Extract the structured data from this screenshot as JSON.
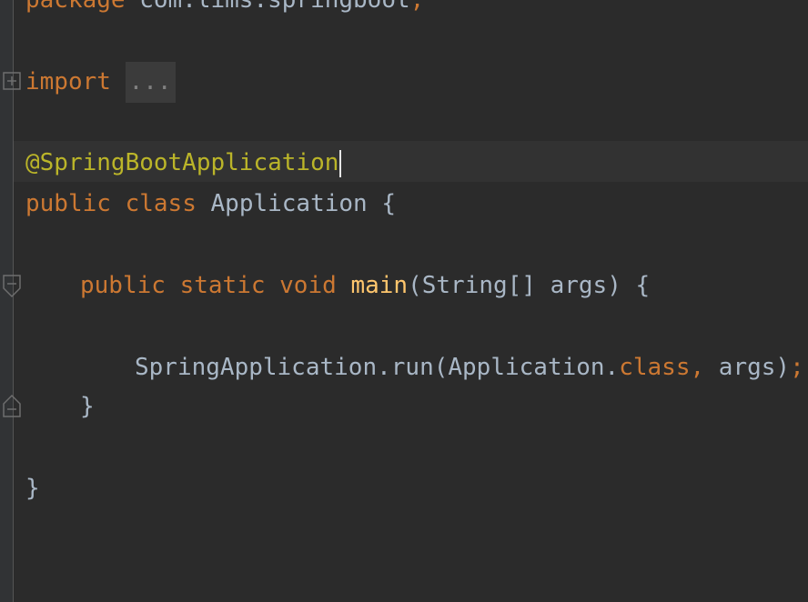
{
  "editor": {
    "colors": {
      "background": "#2b2b2b",
      "keyword": "#cc7832",
      "annotation": "#bbb529",
      "method": "#ffc66d",
      "text": "#a9b7c6",
      "folded": "#808080"
    },
    "lines": {
      "l1_kw": "package",
      "l1_rest": " com.lims.springboot",
      "l1_semi": ";",
      "l2_kw": "import",
      "l2_folded": "...",
      "l3_annotation": "@SpringBootApplication",
      "l4_kw1": "public",
      "l4_kw2": "class",
      "l4_rest": " Application {",
      "l5_kw1": "public",
      "l5_kw2": "static",
      "l5_kw3": "void",
      "l5_fn": "main",
      "l5_rest": "(String[] args) {",
      "l6_a": "SpringApplication.run(Application.",
      "l6_kw": "class",
      "l6_comma": ",",
      "l6_b": " args)",
      "l6_semi": ";",
      "l7_close": "}",
      "l8_close": "}"
    },
    "gutter_icons": [
      "fold-expand-icon",
      "fold-collapse-icon",
      "fold-collapse-icon"
    ]
  }
}
